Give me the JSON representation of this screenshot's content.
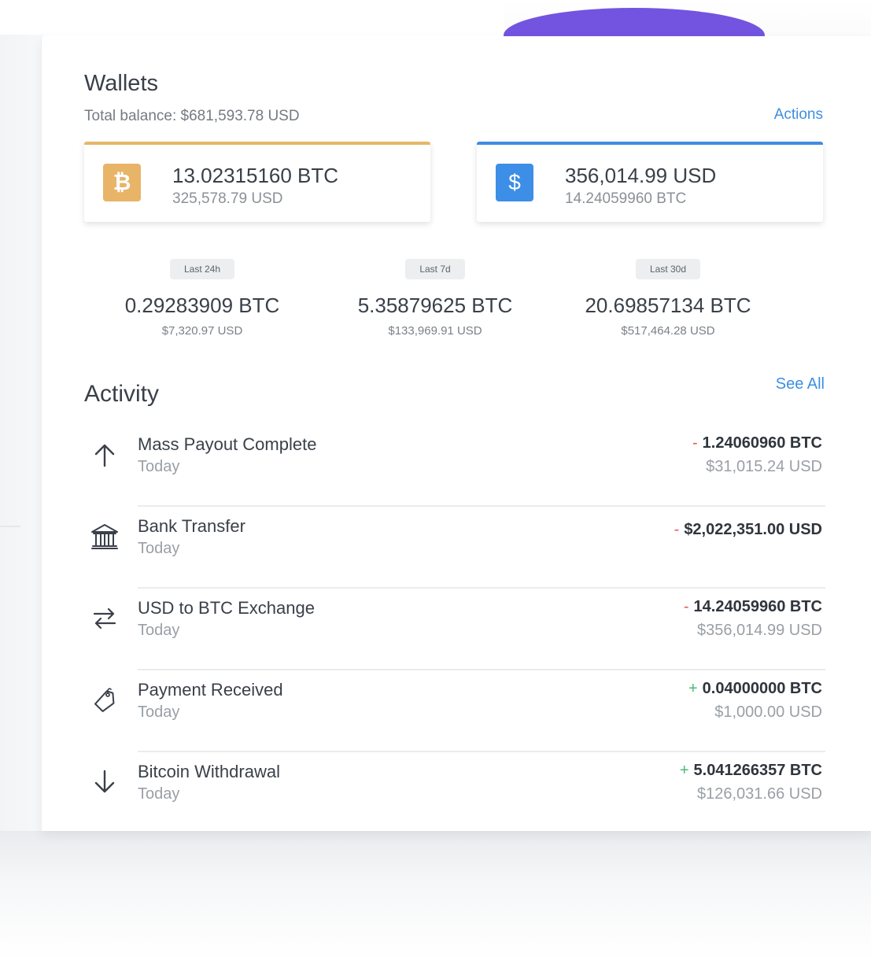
{
  "wallets": {
    "title": "Wallets",
    "total_balance": "Total balance: $681,593.78 USD",
    "actions_label": "Actions",
    "cards": [
      {
        "icon": "bitcoin-icon",
        "symbol": "₿",
        "amount": "13.02315160 BTC",
        "sub": "325,578.79 USD",
        "accent": "#e5b867"
      },
      {
        "icon": "dollar-icon",
        "symbol": "$",
        "amount": "356,014.99 USD",
        "sub": "14.24059960 BTC",
        "accent": "#3f8be0"
      }
    ]
  },
  "stats": [
    {
      "label": "Last 24h",
      "value": "0.29283909 BTC",
      "sub": "$7,320.97 USD"
    },
    {
      "label": "Last 7d",
      "value": "5.35879625 BTC",
      "sub": "$133,969.91 USD"
    },
    {
      "label": "Last 30d",
      "value": "20.69857134 BTC",
      "sub": "$517,464.28 USD"
    }
  ],
  "activity": {
    "title": "Activity",
    "see_all_label": "See All",
    "items": [
      {
        "icon": "arrow-up-icon",
        "name": "Mass Payout Complete",
        "date": "Today",
        "sign": "-",
        "amount": "1.24060960 BTC",
        "sub": "$31,015.24 USD"
      },
      {
        "icon": "bank-icon",
        "name": "Bank Transfer",
        "date": "Today",
        "sign": "-",
        "amount": "$2,022,351.00 USD",
        "sub": ""
      },
      {
        "icon": "exchange-icon",
        "name": "USD to BTC Exchange",
        "date": "Today",
        "sign": "-",
        "amount": "14.24059960 BTC",
        "sub": "$356,014.99 USD"
      },
      {
        "icon": "price-tag-icon",
        "name": "Payment Received",
        "date": "Today",
        "sign": "+",
        "amount": "0.04000000 BTC",
        "sub": "$1,000.00 USD"
      },
      {
        "icon": "arrow-down-icon",
        "name": "Bitcoin Withdrawal",
        "date": "Today",
        "sign": "+",
        "amount": "5.041266357 BTC",
        "sub": "$126,031.66 USD"
      }
    ]
  },
  "colors": {
    "accent_blue": "#3d8fe0",
    "bitcoin_gold": "#e8b468",
    "header_purple": "#7254e0",
    "negative": "#e05a5a",
    "positive": "#4cb87a"
  }
}
